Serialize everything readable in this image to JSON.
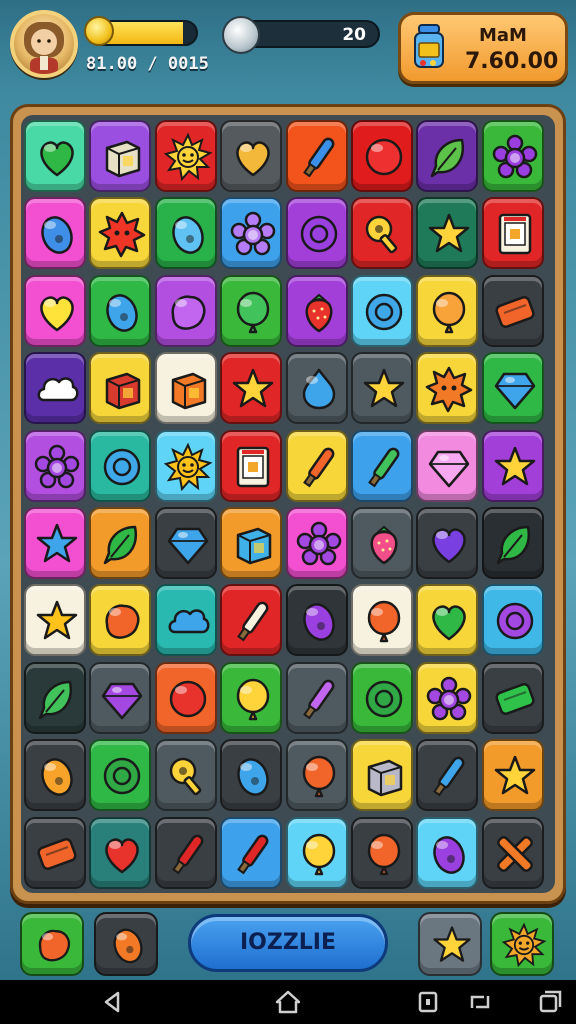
{
  "hud": {
    "player_stat": "81.00 / 0015",
    "xp_progress": 0.88,
    "slider_value": "20",
    "slider_progress": 0.05,
    "wallet_title": "MaM",
    "wallet_value": "7.60.00"
  },
  "board": {
    "rows": [
      [
        [
          "#48d9a6",
          "heart",
          "#2fb845"
        ],
        [
          "#9b4fe0",
          "box",
          "#e6e0c4"
        ],
        [
          "#e02626",
          "sun",
          "#ffd43a"
        ],
        [
          "#555a5e",
          "heart",
          "#f3b73a"
        ],
        [
          "#f2541c",
          "wand",
          "#3a8fe8"
        ],
        [
          "#e01c1c",
          "circle",
          "#ef3030"
        ],
        [
          "#6b2fa8",
          "leaf",
          "#5cc24a"
        ],
        [
          "#39b83a",
          "flower",
          "#9b3ee0"
        ]
      ],
      [
        [
          "#f24fd1",
          "egg",
          "#3f8fe8"
        ],
        [
          "#f7d63a",
          "burst",
          "#ee3526"
        ],
        [
          "#29b14a",
          "egg",
          "#5fc2f2"
        ],
        [
          "#3ea1ec",
          "flower",
          "#b57cf6"
        ],
        [
          "#a23fd9",
          "ring",
          "#9a3fe0"
        ],
        [
          "#e02626",
          "key",
          "#ffd43a"
        ],
        [
          "#1f7a5a",
          "star",
          "#ffd43a"
        ],
        [
          "#e02626",
          "card",
          "#f7f2e0"
        ]
      ],
      [
        [
          "#f24fd1",
          "heart",
          "#ffe23a"
        ],
        [
          "#2fb845",
          "egg",
          "#3fa5ea"
        ],
        [
          "#b34fe0",
          "blob",
          "#c266f0"
        ],
        [
          "#39b83a",
          "balloon",
          "#42c25a"
        ],
        [
          "#a23fd9",
          "berry",
          "#e8322c"
        ],
        [
          "#5fd4f6",
          "ring",
          "#3fa8e8"
        ],
        [
          "#f7d63a",
          "balloon",
          "#f7a33a"
        ],
        [
          "#3a3f44",
          "bar",
          "#f2652a"
        ]
      ],
      [
        [
          "#5a2fa8",
          "cloud",
          "#ffffff"
        ],
        [
          "#f7d63a",
          "box",
          "#d83a2e"
        ],
        [
          "#f7f2e0",
          "box",
          "#f27a26"
        ],
        [
          "#e02626",
          "star",
          "#ffd43a"
        ],
        [
          "#4f5a60",
          "drop",
          "#3fa5ea"
        ],
        [
          "#4f5a60",
          "star",
          "#ffd43a"
        ],
        [
          "#f7d63a",
          "burst",
          "#f27a26"
        ],
        [
          "#2fb845",
          "gem",
          "#3fa5ea"
        ]
      ],
      [
        [
          "#b34fe0",
          "flower",
          "#a348e0"
        ],
        [
          "#29b9a0",
          "ring",
          "#3fa8e8"
        ],
        [
          "#5fd4f6",
          "sun",
          "#ffc21a"
        ],
        [
          "#e02626",
          "card",
          "#f7f2e0"
        ],
        [
          "#f7d63a",
          "wand",
          "#f2652a"
        ],
        [
          "#3ea1ec",
          "wand",
          "#42c25a"
        ],
        [
          "#f28ae0",
          "gem",
          "#f6a8f0"
        ],
        [
          "#a23fd9",
          "star",
          "#ffd43a"
        ]
      ],
      [
        [
          "#f24fd1",
          "star",
          "#3fa5ea"
        ],
        [
          "#f29a2a",
          "leaf",
          "#2fb845"
        ],
        [
          "#3a3f44",
          "gem",
          "#3fa5ea"
        ],
        [
          "#f29a2a",
          "box",
          "#3fb0e8"
        ],
        [
          "#f24fd1",
          "flower",
          "#a348e0"
        ],
        [
          "#4f5a60",
          "berry",
          "#f24f8a"
        ],
        [
          "#3a3f44",
          "heart",
          "#7a3fe0"
        ],
        [
          "#2a2f33",
          "leaf",
          "#2fb845"
        ]
      ],
      [
        [
          "#f7f2e0",
          "star",
          "#ffc21a"
        ],
        [
          "#f7d63a",
          "blob",
          "#f2652a"
        ],
        [
          "#29b9b0",
          "cloud",
          "#3fa5ea"
        ],
        [
          "#e02626",
          "wand",
          "#f7f2e0"
        ],
        [
          "#2f3538",
          "egg",
          "#9a3fe0"
        ],
        [
          "#f7f2e0",
          "balloon",
          "#f2652a"
        ],
        [
          "#f7d63a",
          "heart",
          "#2fb845"
        ],
        [
          "#3fb8e8",
          "ring",
          "#a348e0"
        ]
      ],
      [
        [
          "#2a3a3a",
          "leaf",
          "#42c25a"
        ],
        [
          "#4f5a60",
          "gem",
          "#a348e0"
        ],
        [
          "#f2652a",
          "circle",
          "#e8322c"
        ],
        [
          "#39b83a",
          "balloon",
          "#ffd43a"
        ],
        [
          "#4f5a60",
          "wand",
          "#c266f0"
        ],
        [
          "#39b83a",
          "ring",
          "#2fa845"
        ],
        [
          "#f7d63a",
          "flower",
          "#a348e0"
        ],
        [
          "#3a3f44",
          "bar",
          "#2fc24a"
        ]
      ],
      [
        [
          "#3a3f44",
          "egg",
          "#f7a32a"
        ],
        [
          "#2fb845",
          "ring",
          "#2fa845"
        ],
        [
          "#4f5a60",
          "key",
          "#ffd43a"
        ],
        [
          "#3a3f44",
          "egg",
          "#3fa5ea"
        ],
        [
          "#4f5a60",
          "balloon",
          "#f2652a"
        ],
        [
          "#f7d63a",
          "box",
          "#b8b8c8"
        ],
        [
          "#3a3f44",
          "wand",
          "#3fa5ea"
        ],
        [
          "#f29a2a",
          "star",
          "#ffd43a"
        ]
      ],
      [
        [
          "#3a3f44",
          "bar",
          "#f2652a"
        ],
        [
          "#29807a",
          "heart",
          "#e8322c"
        ],
        [
          "#3a3f44",
          "wand",
          "#e02626"
        ],
        [
          "#3ea1ec",
          "wand",
          "#e02626"
        ],
        [
          "#5fd4f6",
          "balloon",
          "#ffd43a"
        ],
        [
          "#3a3f44",
          "balloon",
          "#f2652a"
        ],
        [
          "#5fd4f6",
          "egg",
          "#9a3fe0"
        ],
        [
          "#3a3f44",
          "cross",
          "#f27a26"
        ]
      ]
    ]
  },
  "bottom": {
    "main_button_label": "IOZZLIE",
    "left_btn1": [
      "#39b83a",
      "blob",
      "#f2652a"
    ],
    "left_btn2": [
      "#3a3f44",
      "egg",
      "#f27a26"
    ],
    "right_btn1": [
      "#6a7680",
      "star",
      "#ffd43a"
    ],
    "right_btn2": [
      "#39b83a",
      "sun",
      "#f2a62a"
    ]
  },
  "nav": {
    "back_icon": "back-icon",
    "home_icon": "home-icon",
    "recent_icon": "recents-icon"
  }
}
